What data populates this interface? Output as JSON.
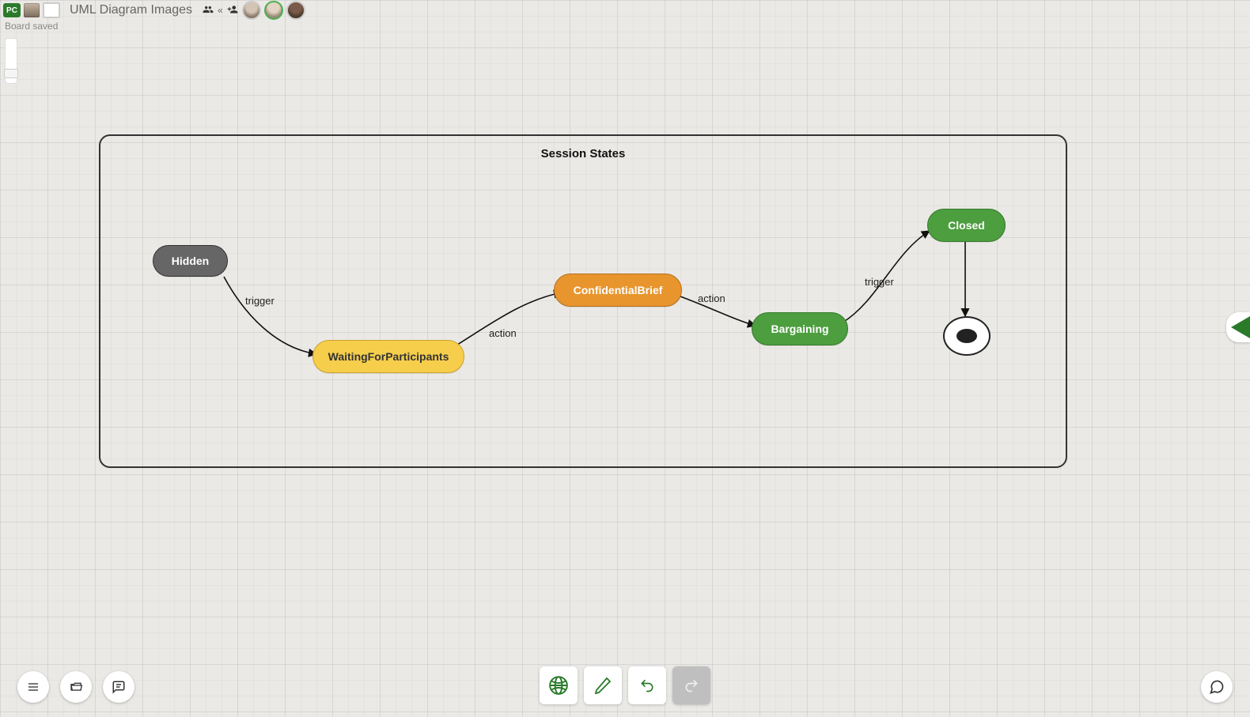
{
  "header": {
    "project_badge": "PC",
    "title": "UML Diagram Images",
    "status": "Board saved"
  },
  "diagram": {
    "title": "Session States",
    "states": {
      "hidden": "Hidden",
      "waiting": "WaitingForParticipants",
      "confidential": "ConfidentialBrief",
      "bargaining": "Bargaining",
      "closed": "Closed"
    },
    "edges": {
      "e1": "trigger",
      "e2": "action",
      "e3": "action",
      "e4": "trigger"
    }
  },
  "toolbar": {
    "globe": "Share",
    "pencil": "Edit",
    "undo": "Undo",
    "redo": "Redo",
    "menu": "Menu",
    "open": "Open",
    "comments": "Comments",
    "chat": "Chat"
  }
}
